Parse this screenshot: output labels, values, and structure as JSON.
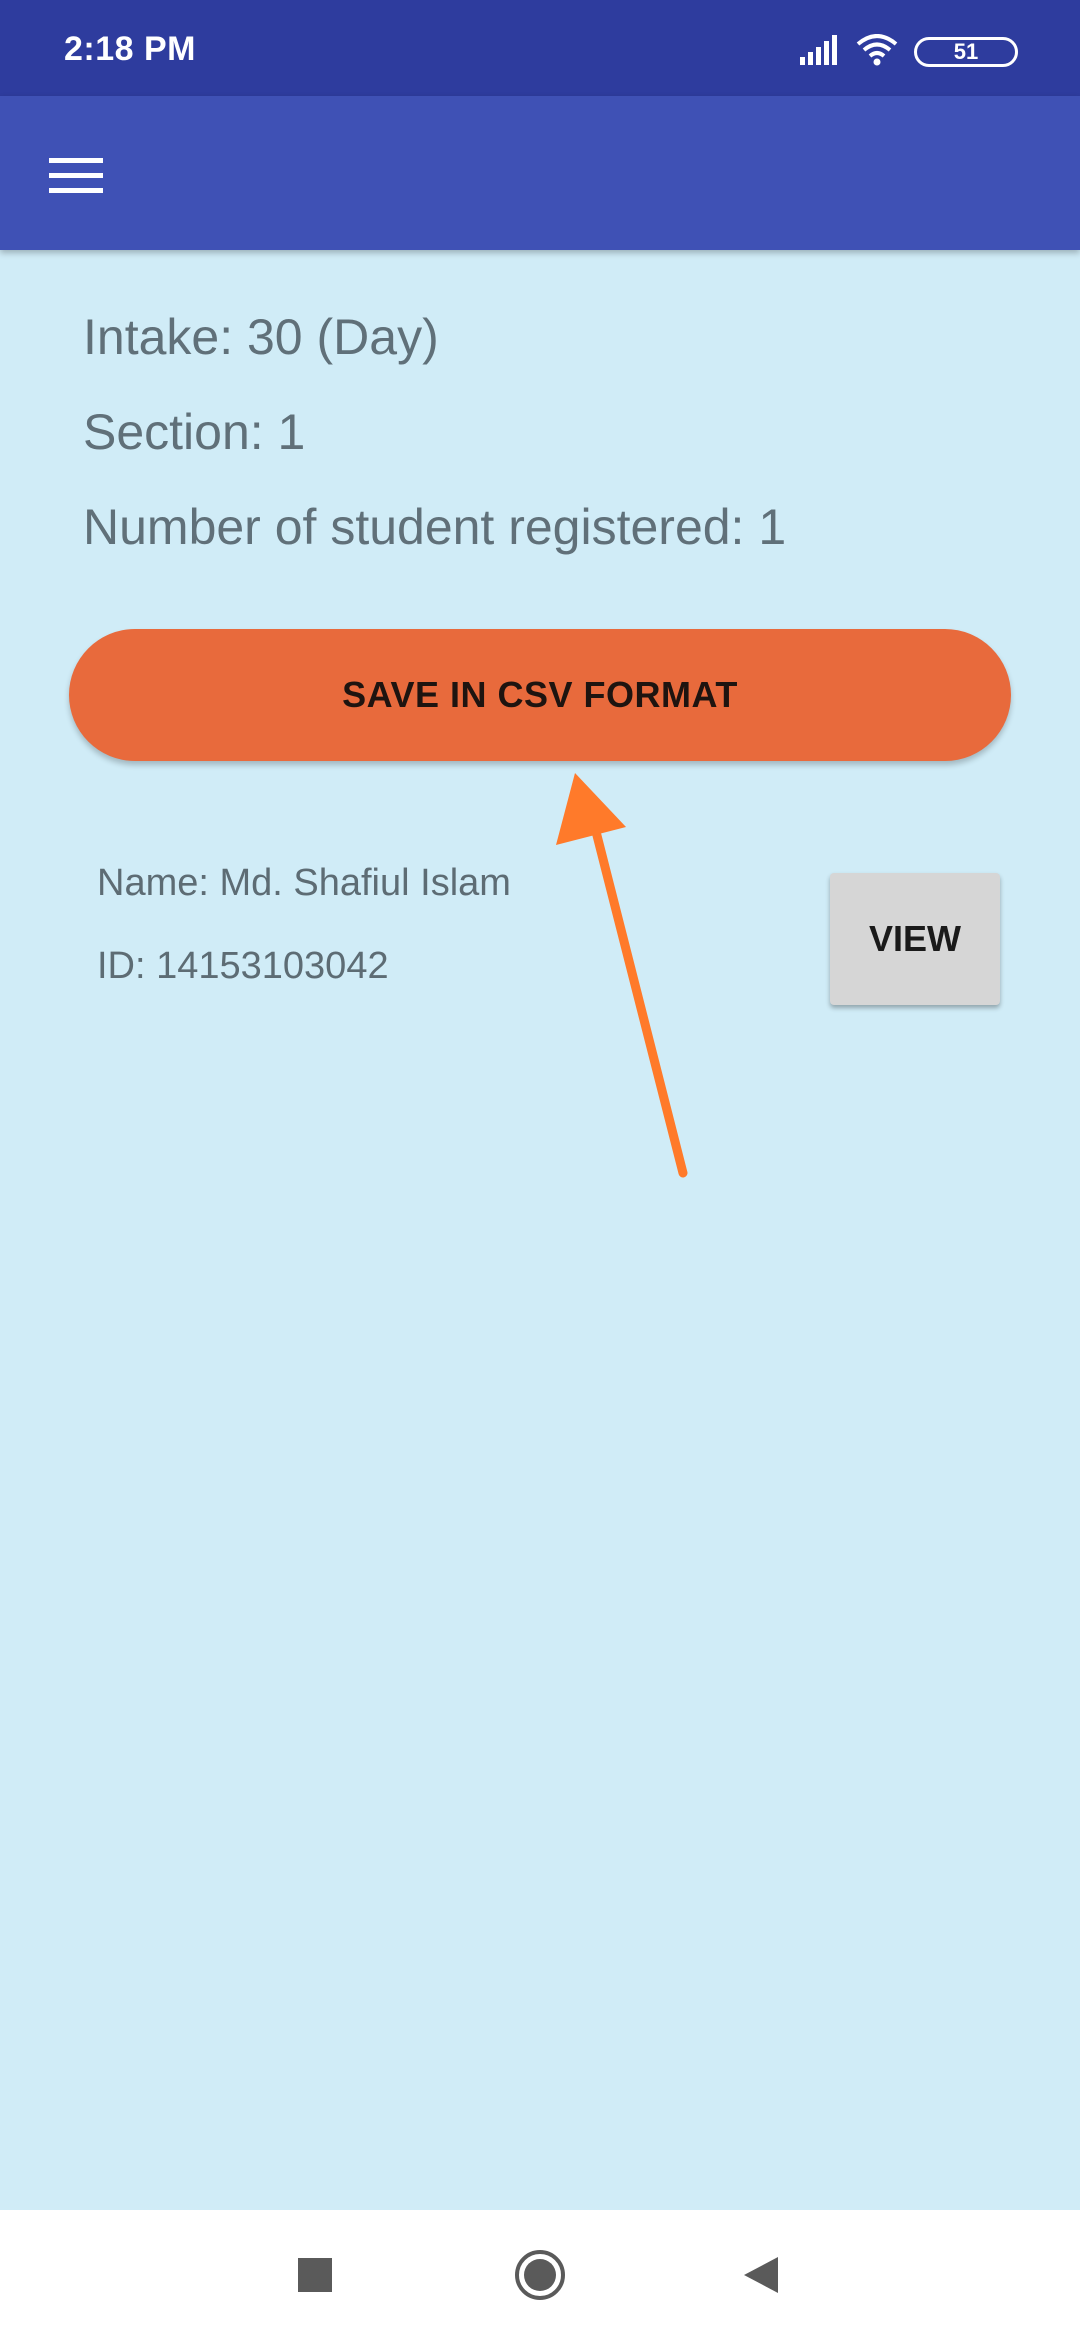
{
  "status_bar": {
    "time": "2:18 PM",
    "battery": "51",
    "icons": [
      "signal-icon",
      "wifi-icon",
      "battery-icon"
    ]
  },
  "app_bar": {
    "menu_icon": "hamburger-menu-icon"
  },
  "class_info": {
    "intake": "Intake: 30 (Day)",
    "section": "Section: 1",
    "registered": "Number of student registered: 1"
  },
  "actions": {
    "save_csv_label": "SAVE IN CSV FORMAT"
  },
  "students": [
    {
      "name": "Name: Md. Shafiul Islam",
      "id": "ID: 14153103042",
      "view_label": "VIEW"
    }
  ],
  "navigation": {
    "buttons": [
      "recents-square-icon",
      "home-circle-icon",
      "back-triangle-icon"
    ]
  },
  "colors": {
    "status_bar": "#2e3c9e",
    "app_bar": "#3f51b5",
    "background": "#d0ecf7",
    "save_button": "#e86a3c",
    "annotation_arrow": "#ff7a2a"
  }
}
